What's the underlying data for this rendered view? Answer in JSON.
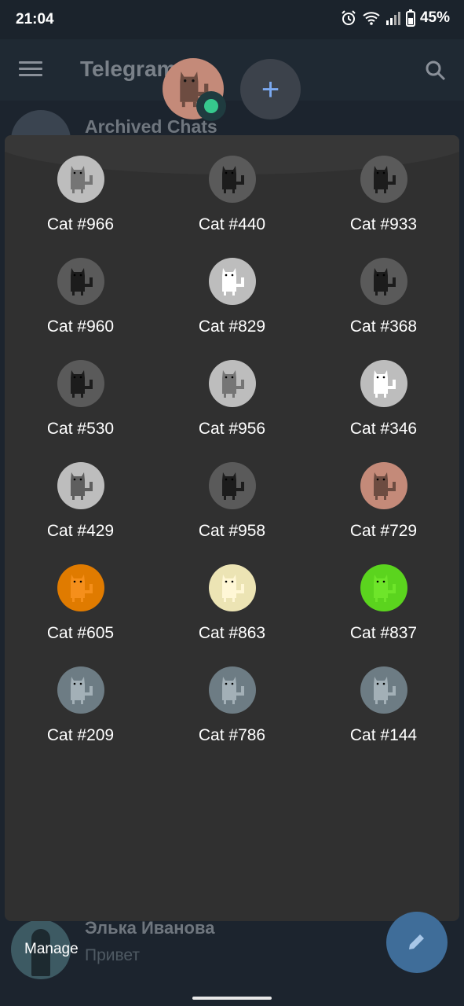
{
  "status_bar": {
    "time": "21:04",
    "battery": "45%"
  },
  "app": {
    "title": "Telegram",
    "archived_label": "Archived Chats"
  },
  "colors": {
    "panel_bg": "#303030",
    "fab_blue": "#3f6d99",
    "add_plus": "#7ba9f0"
  },
  "cats": [
    {
      "label": "Cat #966",
      "bg": "#bdbdbd",
      "body": "#757575"
    },
    {
      "label": "Cat #440",
      "bg": "#5a5a5a",
      "body": "#1c1c1c"
    },
    {
      "label": "Cat #933",
      "bg": "#5a5a5a",
      "body": "#1c1c1c"
    },
    {
      "label": "Cat #960",
      "bg": "#5a5a5a",
      "body": "#1c1c1c"
    },
    {
      "label": "Cat #829",
      "bg": "#bdbdbd",
      "body": "#ffffff"
    },
    {
      "label": "Cat #368",
      "bg": "#5a5a5a",
      "body": "#1c1c1c"
    },
    {
      "label": "Cat #530",
      "bg": "#5a5a5a",
      "body": "#1c1c1c"
    },
    {
      "label": "Cat #956",
      "bg": "#bdbdbd",
      "body": "#757575"
    },
    {
      "label": "Cat #346",
      "bg": "#bdbdbd",
      "body": "#ffffff"
    },
    {
      "label": "Cat #429",
      "bg": "#bdbdbd",
      "body": "#5e5e5e"
    },
    {
      "label": "Cat #958",
      "bg": "#5a5a5a",
      "body": "#1c1c1c"
    },
    {
      "label": "Cat #729",
      "bg": "#c48a79",
      "body": "#6d4c41"
    },
    {
      "label": "Cat #605",
      "bg": "#e07b00",
      "body": "#f58f1b"
    },
    {
      "label": "Cat #863",
      "bg": "#ece4b4",
      "body": "#fff7d6"
    },
    {
      "label": "Cat #837",
      "bg": "#5bd41e",
      "body": "#6ee52a"
    },
    {
      "label": "Cat #209",
      "bg": "#6d7c84",
      "body": "#a3b0b7"
    },
    {
      "label": "Cat #786",
      "bg": "#6d7c84",
      "body": "#a3b0b7"
    },
    {
      "label": "Cat #144",
      "bg": "#6d7c84",
      "body": "#a3b0b7"
    }
  ],
  "chat": {
    "name": "Элька Иванова",
    "message": "Привет"
  },
  "manage_label": "Manage",
  "icons": {
    "menu": "menu-icon",
    "search": "search-icon",
    "add": "plus-icon",
    "fab": "pencil-icon",
    "alarm": "alarm-icon",
    "wifi": "wifi-icon",
    "signal": "signal-icon",
    "battery": "battery-icon"
  }
}
